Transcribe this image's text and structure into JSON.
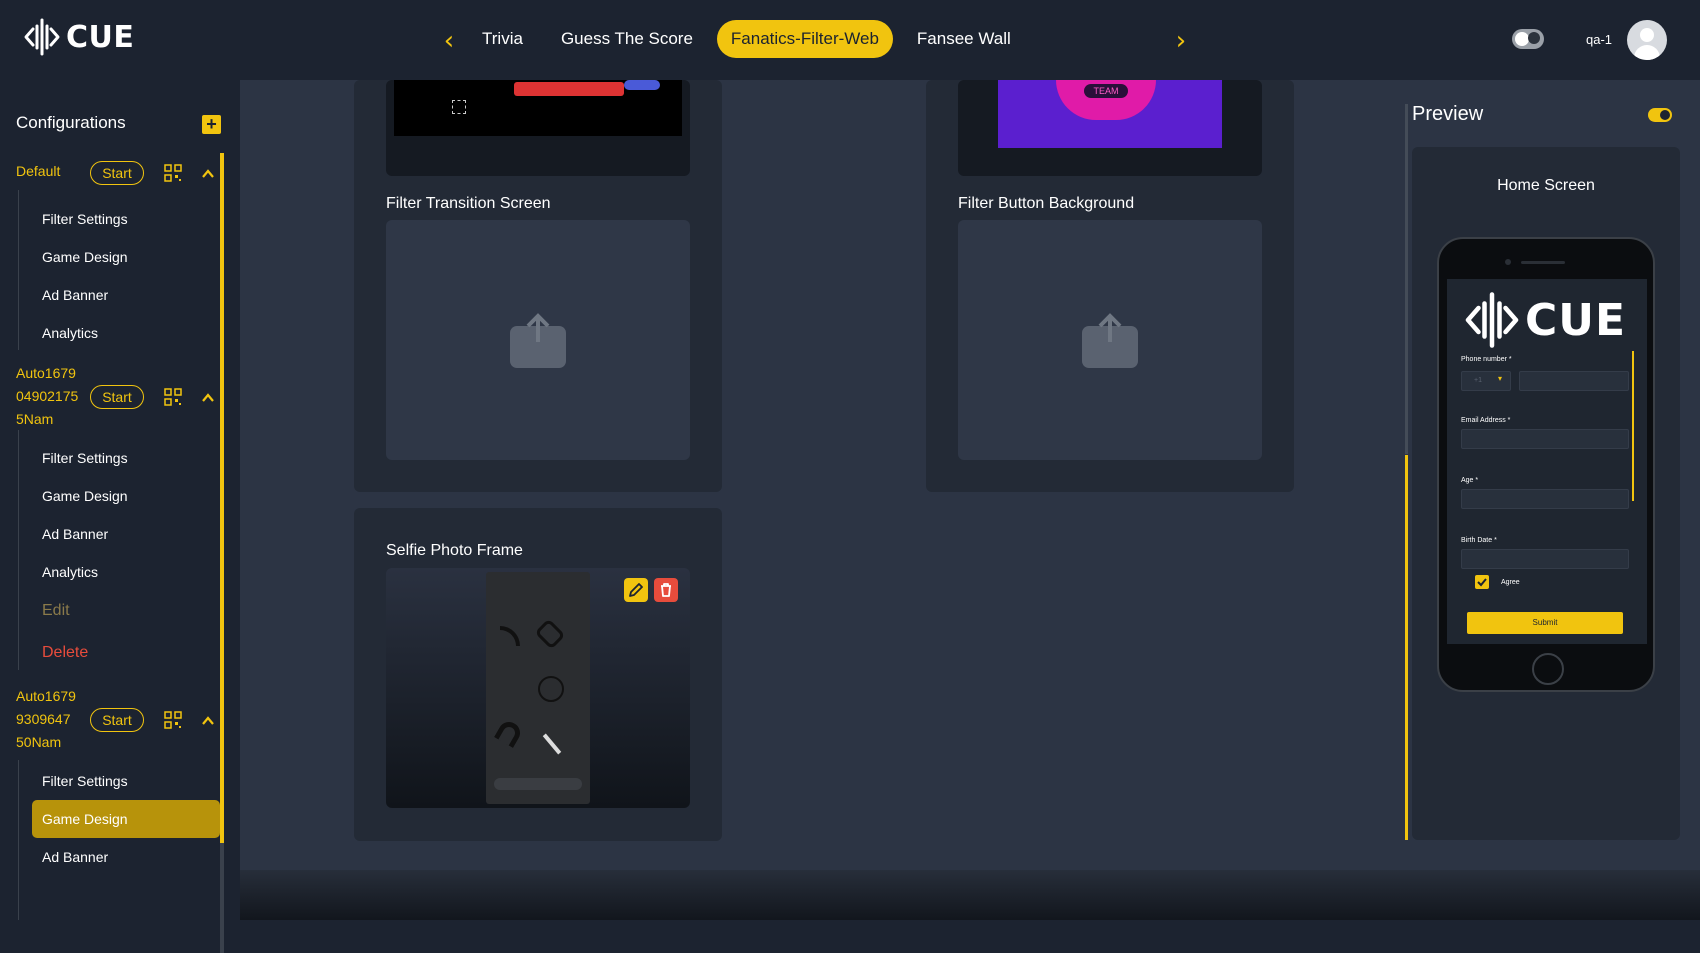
{
  "app": {
    "logo_text": "CUE",
    "accent": "#f1c40f"
  },
  "header": {
    "tabs": [
      {
        "label": "Trivia"
      },
      {
        "label": "Guess The Score"
      },
      {
        "label": "Fanatics-Filter-Web"
      },
      {
        "label": "Fansee Wall"
      }
    ],
    "active_tab": "Fanatics-Filter-Web",
    "username": "qa-1"
  },
  "sidebar": {
    "title": "Configurations",
    "configs": [
      {
        "name_lines": [
          "Default"
        ],
        "start_label": "Start",
        "items": [
          "Filter Settings",
          "Game Design",
          "Ad Banner",
          "Analytics"
        ]
      },
      {
        "name_lines": [
          "Auto1679",
          "04902175",
          "5Nam"
        ],
        "start_label": "Start",
        "items": [
          "Filter Settings",
          "Game Design",
          "Ad Banner",
          "Analytics"
        ],
        "edit_label": "Edit",
        "delete_label": "Delete"
      },
      {
        "name_lines": [
          "Auto1679",
          "9309647",
          "50Nam"
        ],
        "start_label": "Start",
        "items": [
          "Filter Settings",
          "Game Design",
          "Ad Banner"
        ],
        "active_item": "Game Design"
      }
    ]
  },
  "main": {
    "cards": [
      {
        "title": "Filter Transition Screen"
      },
      {
        "title": "Filter Button Background"
      },
      {
        "title": "Selfie Photo Frame"
      }
    ],
    "team_text": "TEAM"
  },
  "preview": {
    "title": "Preview",
    "screen_title": "Home Screen",
    "form": {
      "phone_label": "Phone number *",
      "country_code": "+1",
      "email_label": "Email Address *",
      "age_label": "Age *",
      "birth_label": "Birth Date *",
      "agree_label": "Agree",
      "submit_label": "Submit"
    }
  }
}
